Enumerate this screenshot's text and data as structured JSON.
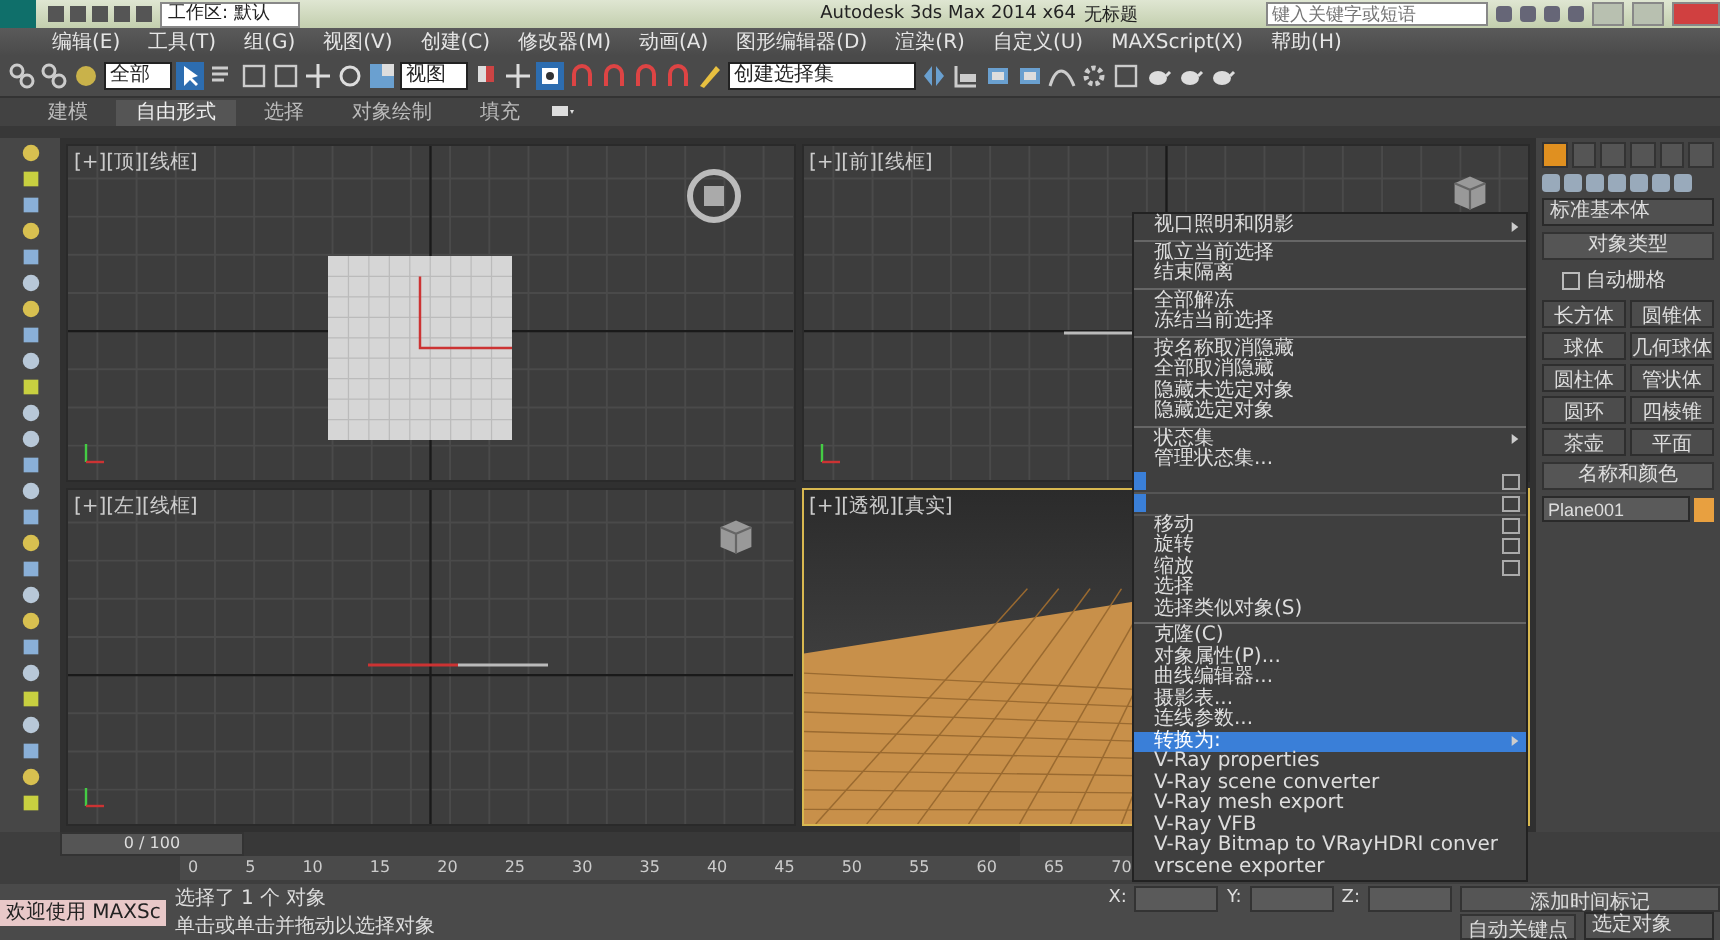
{
  "title_bar": {
    "workspace": "工作区: 默认",
    "app_title": "Autodesk 3ds Max  2014 x64",
    "file_title": "无标题",
    "search": {
      "placeholder": "键入关键字或短语"
    }
  },
  "menu_bar": [
    "编辑(E)",
    "工具(T)",
    "组(G)",
    "视图(V)",
    "创建(C)",
    "修改器(M)",
    "动画(A)",
    "图形编辑器(D)",
    "渲染(R)",
    "自定义(U)",
    "MAXScript(X)",
    "帮助(H)"
  ],
  "toolbar": {
    "selection_filter": "全部",
    "reference_coord": "视图",
    "selection_set": "创建选择集"
  },
  "ribbon_tabs": [
    {
      "label": "建模",
      "selected": false
    },
    {
      "label": "自由形式",
      "selected": true
    },
    {
      "label": "选择",
      "selected": false
    },
    {
      "label": "对象绘制",
      "selected": false
    },
    {
      "label": "填充",
      "selected": false
    }
  ],
  "viewports": [
    {
      "label": "[+][顶][线框]",
      "kind": "top",
      "active": false
    },
    {
      "label": "[+][前][线框]",
      "kind": "front",
      "active": false
    },
    {
      "label": "[+][左][线框]",
      "kind": "left",
      "active": false
    },
    {
      "label": "[+][透视][真实]",
      "kind": "perspective",
      "active": true
    }
  ],
  "command_panel": {
    "tabs": [
      {
        "selected": true
      },
      {
        "selected": false
      },
      {
        "selected": false
      },
      {
        "selected": false
      },
      {
        "selected": false
      },
      {
        "selected": false
      }
    ],
    "category": "标准基本体",
    "object_type_title": "对象类型",
    "autogrid": {
      "label": "自动栅格",
      "checked": false
    },
    "buttons": [
      "长方体",
      "圆锥体",
      "球体",
      "几何球体",
      "圆柱体",
      "管状体",
      "圆环",
      "四棱锥",
      "茶壶",
      "平面"
    ],
    "name_color_title": "名称和颜色",
    "object_name": "Plane001"
  },
  "quad_menu": [
    {
      "kind": "item",
      "label": "视口照明和阴影",
      "submenu": true,
      "selected": false
    },
    {
      "kind": "separator"
    },
    {
      "kind": "item",
      "label": "孤立当前选择",
      "submenu": false,
      "selected": false
    },
    {
      "kind": "item",
      "label": "结束隔离",
      "submenu": false,
      "selected": false
    },
    {
      "kind": "separator"
    },
    {
      "kind": "item",
      "label": "全部解冻",
      "submenu": false,
      "selected": false
    },
    {
      "kind": "item",
      "label": "冻结当前选择",
      "submenu": false,
      "selected": false
    },
    {
      "kind": "separator"
    },
    {
      "kind": "item",
      "label": "按名称取消隐藏",
      "submenu": false,
      "selected": false
    },
    {
      "kind": "item",
      "label": "全部取消隐藏",
      "submenu": false,
      "selected": false
    },
    {
      "kind": "item",
      "label": "隐藏未选定对象",
      "submenu": false,
      "selected": false
    },
    {
      "kind": "item",
      "label": "隐藏选定对象",
      "submenu": false,
      "selected": false
    },
    {
      "kind": "separator"
    },
    {
      "kind": "item",
      "label": "状态集",
      "submenu": true,
      "selected": false
    },
    {
      "kind": "item",
      "label": "管理状态集...",
      "submenu": false,
      "selected": false
    },
    {
      "kind": "blank"
    },
    {
      "kind": "blank"
    },
    {
      "kind": "item",
      "label": "移动",
      "submenu": false,
      "selected": false,
      "has_settings": true
    },
    {
      "kind": "item",
      "label": "旋转",
      "submenu": false,
      "selected": false,
      "has_settings": true
    },
    {
      "kind": "item",
      "label": "缩放",
      "submenu": false,
      "selected": false,
      "has_settings": true
    },
    {
      "kind": "item",
      "label": "选择",
      "submenu": false,
      "selected": false
    },
    {
      "kind": "item",
      "label": "选择类似对象(S)",
      "submenu": false,
      "selected": false
    },
    {
      "kind": "separator"
    },
    {
      "kind": "item",
      "label": "克隆(C)",
      "submenu": false,
      "selected": false
    },
    {
      "kind": "item",
      "label": "对象属性(P)...",
      "submenu": false,
      "selected": false
    },
    {
      "kind": "item",
      "label": "曲线编辑器...",
      "submenu": false,
      "selected": false
    },
    {
      "kind": "item",
      "label": "摄影表...",
      "submenu": false,
      "selected": false
    },
    {
      "kind": "item",
      "label": "连线参数...",
      "submenu": false,
      "selected": false
    },
    {
      "kind": "item",
      "label": "转换为:",
      "submenu": true,
      "selected": true
    },
    {
      "kind": "item",
      "label": "V-Ray properties",
      "submenu": false,
      "selected": false
    },
    {
      "kind": "item",
      "label": "V-Ray scene converter",
      "submenu": false,
      "selected": false
    },
    {
      "kind": "item",
      "label": "V-Ray mesh export",
      "submenu": false,
      "selected": false
    },
    {
      "kind": "item",
      "label": "V-Ray VFB",
      "submenu": false,
      "selected": false
    },
    {
      "kind": "item",
      "label": "V-Ray Bitmap to VRayHDRI conver",
      "submenu": false,
      "selected": false
    },
    {
      "kind": "item",
      "label": "vrscene exporter",
      "submenu": false,
      "selected": false
    }
  ],
  "timeline": {
    "frame": "0 / 100",
    "level": 0,
    "ticks": [
      "0",
      "5",
      "10",
      "15",
      "20",
      "25",
      "30",
      "35",
      "40",
      "45",
      "50",
      "55",
      "60",
      "65",
      "70"
    ]
  },
  "status_bar": {
    "maxscript": "欢迎使用 MAXSc",
    "selection": "选择了 1 个 对象",
    "prompt": "单击或单击并拖动以选择对象",
    "coords": [
      "X:",
      "Y:",
      "Z:"
    ],
    "add_time_tag": "添加时间标记",
    "auto_key": "自动关键点",
    "key_filter": "选定对象"
  }
}
